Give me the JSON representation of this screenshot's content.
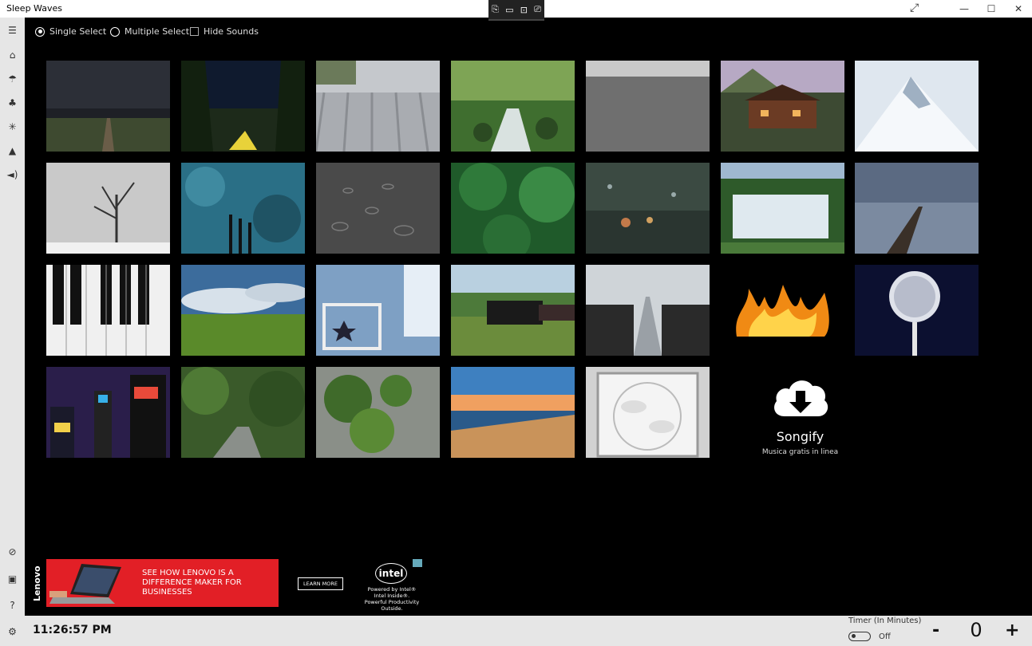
{
  "window": {
    "title": "Sleep Waves"
  },
  "options": {
    "single_select": "Single Select",
    "multiple_select": "Multiple Select",
    "hide_sounds": "Hide Sounds"
  },
  "tiles": [
    "storm-field",
    "tent-night",
    "tin-roof",
    "forest-stream",
    "gravel-road",
    "cabin",
    "snowy-mountain",
    "snow-tree",
    "wind-chimes",
    "rain-puddle",
    "jungle",
    "rain-window",
    "waterfall",
    "pier-lake",
    "piano-keys",
    "grass-field",
    "nursery",
    "steam-train",
    "airplane-cabin",
    "fire",
    "pedestal-fan",
    "city-night",
    "forest-path",
    "leaves-fence",
    "beach-sunset",
    "box-fan"
  ],
  "songify": {
    "name": "Songify",
    "subtitle": "Musica gratis in linea"
  },
  "ad": {
    "brand": "Lenovo",
    "headline": "SEE HOW LENOVO IS A DIFFERENCE MAKER FOR BUSINESSES",
    "cta": "LEARN MORE",
    "intel_logo": "intel",
    "intel_text": "Powered by Intel® Intel Inside®. Powerful Productivity Outside."
  },
  "status": {
    "clock": "11:26:57 PM",
    "timer_label": "Timer (In Minutes)",
    "timer_state": "Off",
    "timer_value": "0",
    "minus": "-",
    "plus": "+"
  }
}
